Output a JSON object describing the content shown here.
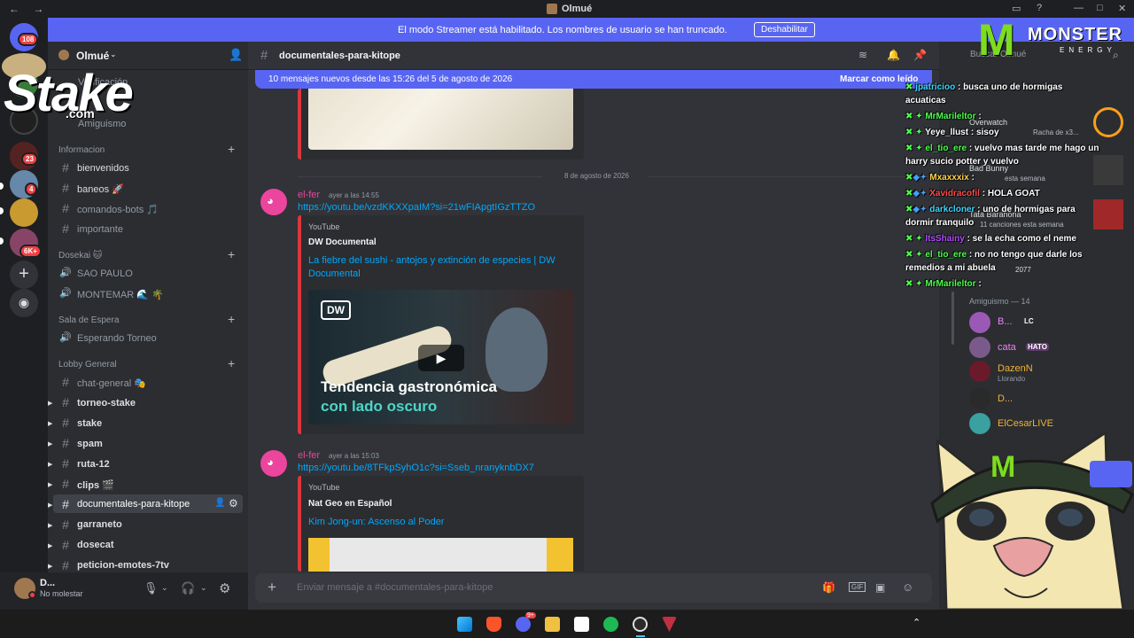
{
  "window": {
    "title": "Olmué",
    "nav_glyphs": "← →"
  },
  "streamer_banner": {
    "text": "El modo Streamer está habilitado. Los nombres de usuario se han truncado.",
    "button": "Deshabilitar"
  },
  "rail": {
    "badges": [
      "108",
      "23",
      "4",
      "6K+"
    ]
  },
  "server": {
    "name": "Olmué"
  },
  "sidebar": {
    "top_items": [
      {
        "label": "Verificación"
      },
      {
        "label": "Amiguismo"
      }
    ],
    "categories": [
      {
        "name": "Informacion",
        "channels": [
          {
            "label": "bienvenidos",
            "emoji": ""
          },
          {
            "label": "baneos 🚀"
          },
          {
            "label": "comandos-bots 🎵"
          },
          {
            "label": "importante"
          }
        ]
      },
      {
        "name": "Dosekai 🐱",
        "channels": [
          {
            "label": "SAO PAULO"
          },
          {
            "label": "MONTEMAR 🌊 🌴"
          }
        ]
      },
      {
        "name": "Sala de Espera",
        "channels": [
          {
            "label": "Esperando Torneo"
          }
        ]
      },
      {
        "name": "Lobby General",
        "channels": [
          {
            "label": "chat-general 🎭"
          },
          {
            "label": "torneo-stake"
          },
          {
            "label": "stake"
          },
          {
            "label": "spam"
          },
          {
            "label": "ruta-12"
          },
          {
            "label": "clips 🎬"
          },
          {
            "label": "documentales-para-kitope"
          },
          {
            "label": "garraneto"
          },
          {
            "label": "dosecat"
          },
          {
            "label": "peticion-emotes-7tv"
          }
        ]
      }
    ]
  },
  "user_panel": {
    "name": "D...",
    "status": "No molestar"
  },
  "chat": {
    "channel": "documentales-para-kitope",
    "search_placeholder": "Buscar Olmué",
    "new_messages": "10 mensajes nuevos desde las 15:26 del 5 de agosto de 2026",
    "mark_read": "Marcar como leído",
    "date_divider": "8 de agosto de 2026",
    "messages": [
      {
        "author": "el-fer",
        "time": "ayer a las 14:55",
        "url": "https://youtu.be/vzdKKXXpaIM?si=21wFIApgtIGzTTZO",
        "provider": "YouTube",
        "embed_author": "DW Documental",
        "embed_title": "La fiebre del sushi - antojos y extinción de especies | DW Documental",
        "thumb_logo": "DW",
        "thumb_line1": "Tendencia gastronómica",
        "thumb_line2": "con lado oscuro"
      },
      {
        "author": "el-fer",
        "time": "ayer a las 15:03",
        "url": "https://youtu.be/8TFkpSyhO1c?si=Sseb_nranyknbDX7",
        "provider": "YouTube",
        "embed_author": "Nat Geo en Español",
        "embed_title": "Kim Jong-un: Ascenso al Poder"
      }
    ],
    "input_placeholder": "Enviar mensaje a #documentales-para-kitope"
  },
  "stream_chat": [
    {
      "user": "jpatricioo",
      "color": "#3fd7ff",
      "text": ": busca uno de hormigas acuaticas"
    },
    {
      "user": "MrMarileltor",
      "color": "#4cff4c",
      "text": ":"
    },
    {
      "user": "Yeye_llust",
      "color": "#ffffff",
      "text": ": sisoy"
    },
    {
      "user": "el_tio_ere",
      "color": "#4cff4c",
      "text": ": vuelvo mas tarde me hago un harry sucio potter y vuelvo"
    },
    {
      "user": "Mxaxxxix",
      "color": "#ffd24c",
      "text": ":"
    },
    {
      "user": "Xavidracofil",
      "color": "#ff4c4c",
      "text": ": HOLA GOAT"
    },
    {
      "user": "darkcloner",
      "color": "#3fd7ff",
      "text": ": uno de hormigas para dormir tranquilo"
    },
    {
      "user": "ItsShainy",
      "color": "#b04cff",
      "text": ": se la echa como el neme"
    },
    {
      "user": "el_tio_ere",
      "color": "#4cff4c",
      "text": ": no no tengo que darle los remedios a mi abuela"
    },
    {
      "user": "MrMarileltor",
      "color": "#4cff4c",
      "text": ":"
    }
  ],
  "activity": [
    {
      "title": "Overwatch",
      "sub": "Racha de x3..."
    },
    {
      "title": "Bad Bunny",
      "sub": "esta semana"
    },
    {
      "title": "Tata Barahona",
      "sub": "11 canciones esta semana"
    }
  ],
  "members": {
    "header": "Amiguismo — 14",
    "list": [
      {
        "name": "B...",
        "tag": "LC",
        "color": "#f47fff",
        "sub": ""
      },
      {
        "name": "cata",
        "tag": "HATO",
        "color": "#f47fff",
        "sub": ""
      },
      {
        "name": "DazenN",
        "tag": "",
        "color": "#f0b232",
        "sub": "Llorando"
      },
      {
        "name": "D...",
        "tag": "",
        "color": "#f0b232",
        "sub": ""
      },
      {
        "name": "ElCesarLIVE",
        "tag": "",
        "color": "#f0b232",
        "sub": ""
      }
    ],
    "count_tag": "2077"
  },
  "overlay": {
    "brand": "Stake",
    "brand_sub": ".com",
    "sponsor": "MONSTER",
    "sponsor_sub": "ENERGY"
  },
  "taskbar": {
    "apps": [
      "windows-start",
      "brave",
      "discord",
      "files",
      "capture",
      "spotify",
      "obs",
      "launcher"
    ],
    "discord_badge": "9+"
  }
}
